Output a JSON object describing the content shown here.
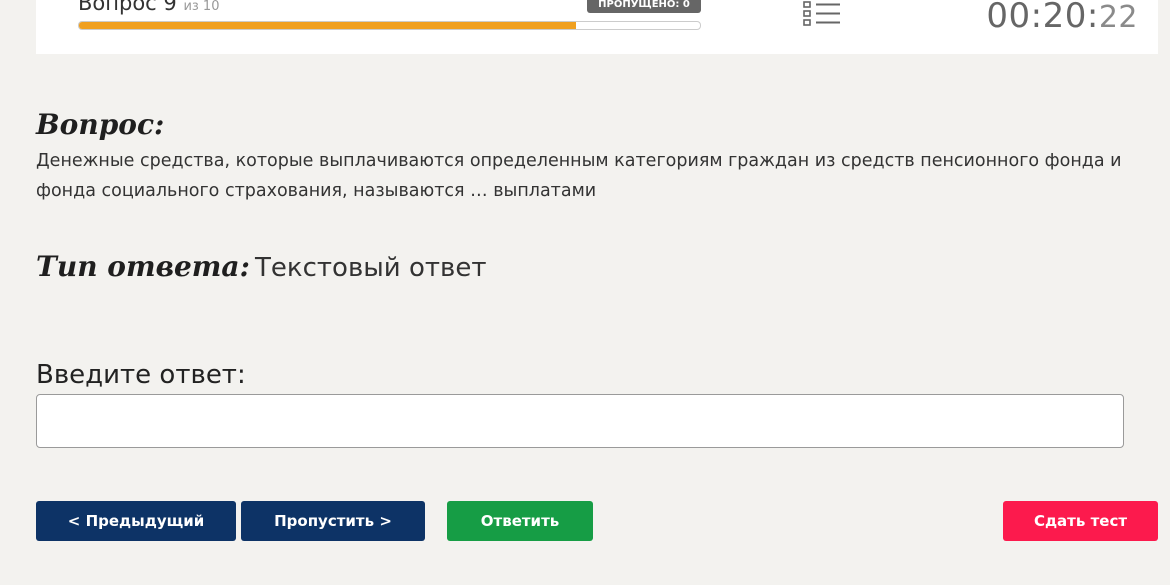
{
  "header": {
    "question_label": "Вопрос 9",
    "question_of": "из 10",
    "progress_fraction": 0.8,
    "skipped_label": "ПРОПУЩЕНО: 0",
    "list_icon": "list-icon",
    "timer_main": "00:20:",
    "timer_seconds": "22"
  },
  "question": {
    "heading": "Вопрос:",
    "text": "Денежные средства, которые выплачиваются определенным категориям граждан из средств пенсионного фонда и фонда социального страхования, называются … выплатами"
  },
  "answer_type": {
    "label": "Тип ответа:",
    "value": "Текстовый ответ"
  },
  "answer": {
    "label": "Введите ответ:",
    "value": "",
    "placeholder": ""
  },
  "buttons": {
    "prev": "< Предыдущий",
    "skip": "Пропустить >",
    "answer": "Ответить",
    "submit": "Сдать тест"
  },
  "colors": {
    "nav_button": "#0d3366",
    "answer_button": "#169d45",
    "submit_button": "#fc1a4d",
    "progress_fill": "#f0a020"
  }
}
